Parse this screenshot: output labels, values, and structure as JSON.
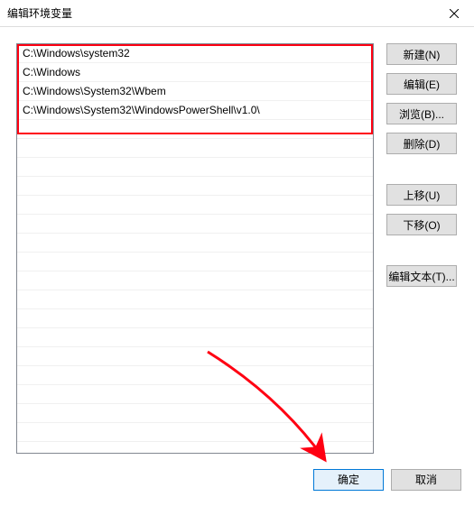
{
  "title": "编辑环境变量",
  "list_items": [
    "C:\\Windows\\system32",
    "C:\\Windows",
    "C:\\Windows\\System32\\Wbem",
    "C:\\Windows\\System32\\WindowsPowerShell\\v1.0\\"
  ],
  "buttons": {
    "new": "新建(N)",
    "edit": "编辑(E)",
    "browse": "浏览(B)...",
    "delete": "删除(D)",
    "move_up": "上移(U)",
    "move_down": "下移(O)",
    "edit_text": "编辑文本(T)...",
    "ok": "确定",
    "cancel": "取消"
  }
}
